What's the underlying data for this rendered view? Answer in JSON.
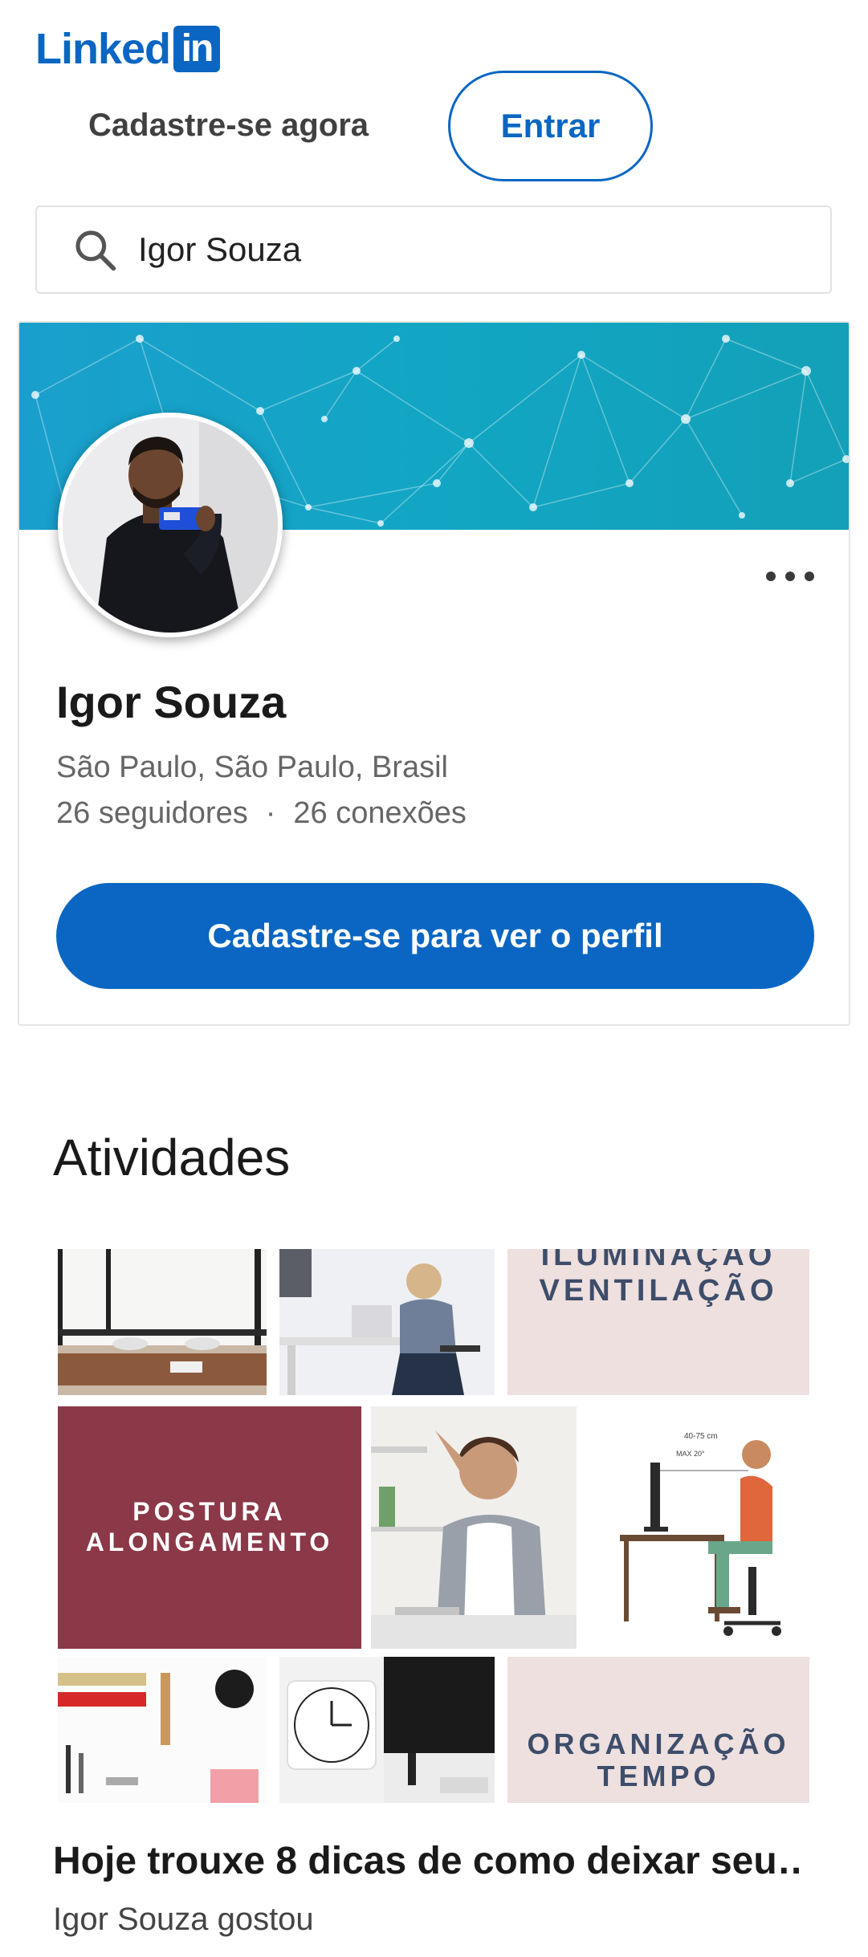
{
  "header": {
    "logo_text": "Linked",
    "logo_box_text": "in",
    "signup_label": "Cadastre-se agora",
    "signin_label": "Entrar",
    "brand_color": "#0a66c2"
  },
  "search": {
    "value": "Igor Souza",
    "icon": "search-icon"
  },
  "profile": {
    "name": "Igor Souza",
    "location": "São Paulo, São Paulo, Brasil",
    "followers": "26 seguidores",
    "separator": "·",
    "connections": "26 conexões",
    "cta_label": "Cadastre-se para ver o perfil",
    "more_icon": "ellipsis-icon"
  },
  "activities": {
    "title": "Atividades",
    "post": {
      "tiles": {
        "ventilation": "ILUMINAÇÃO\nVENTILAÇÃO",
        "posture_line1": "POSTURA",
        "posture_line2": "ALONGAMENTO",
        "organization_line1": "ORGANIZAÇÃO",
        "organization_line2": "TEMPO",
        "ergonomics_dim_top": "40-75 cm",
        "ergonomics_dim_angle": "MAX 20°"
      },
      "title": "Hoje trouxe 8 dicas de como deixar seu…",
      "subtitle": "Igor Souza gostou"
    }
  }
}
